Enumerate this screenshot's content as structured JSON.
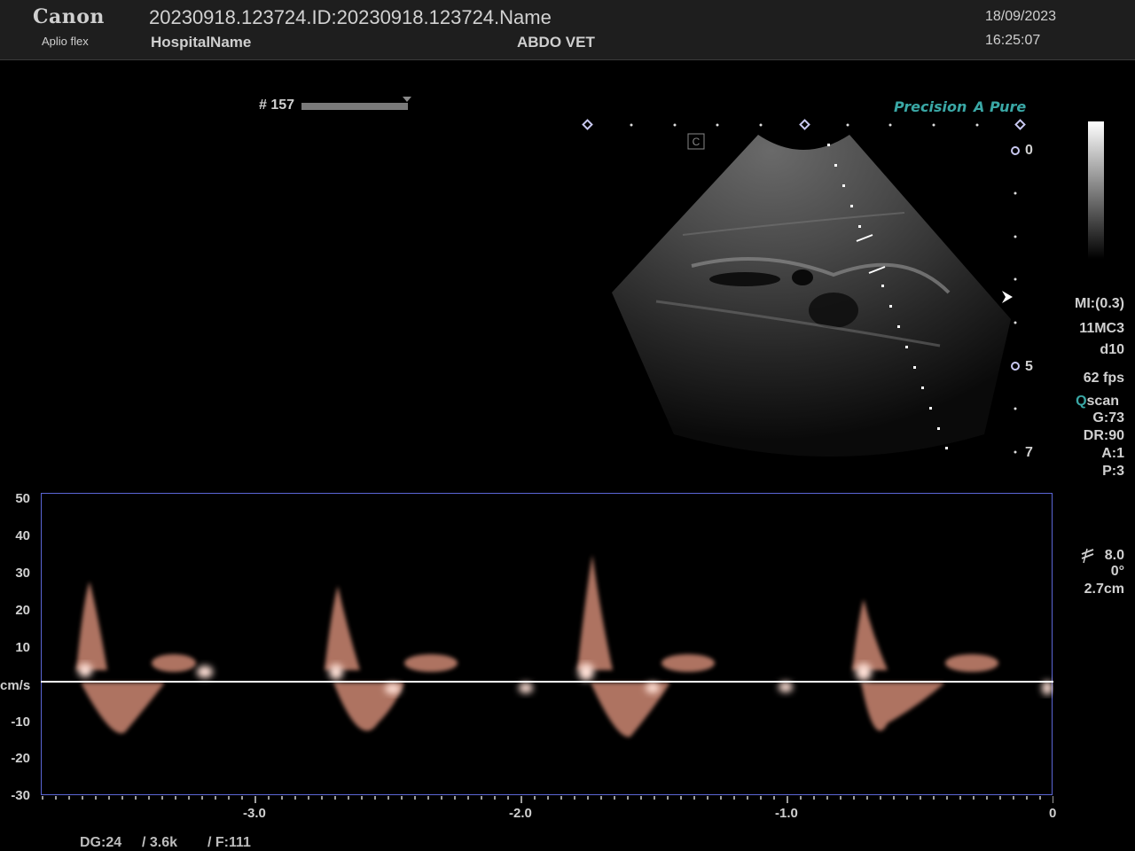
{
  "header": {
    "brand": "Canon",
    "model": "Aplio flex",
    "patient_line": "20230918.123724.ID:20230918.123724.Name",
    "hospital": "HospitalName",
    "exam": "ABDO VET",
    "date": "18/09/2023",
    "time": "16:25:07"
  },
  "frame": {
    "label": "# 157"
  },
  "tags": {
    "precision": "Precision",
    "pure": "A Pure"
  },
  "depth_scale": {
    "labels": [
      "0",
      "5",
      "7"
    ]
  },
  "params": {
    "mi": "MI:(0.3)",
    "probe": "11MC3",
    "depth": "d10",
    "fps": "62 fps",
    "qscan_q": "Q",
    "qscan_rest": "scan",
    "gain": "G:73",
    "dr": "DR:90",
    "a": "A:1",
    "p": "P:3"
  },
  "doppler_params": {
    "sample_volume": "8.0",
    "angle": "0°",
    "depth": "2.7cm"
  },
  "spectral": {
    "y_ticks": [
      "50",
      "40",
      "30",
      "20",
      "10",
      "cm/s",
      "-10",
      "-20",
      "-30"
    ],
    "x_ticks": [
      "-3.0",
      "-2.0",
      "-1.0",
      "0"
    ]
  },
  "bottom": {
    "dg": "DG:24",
    "prf": "/ 3.6k",
    "filter": "/ F:111"
  },
  "colors": {
    "spectral_border": "#5b66d6",
    "baseline": "#ffffff",
    "doppler": "#e89a82",
    "accent": "#3aa8a6"
  }
}
